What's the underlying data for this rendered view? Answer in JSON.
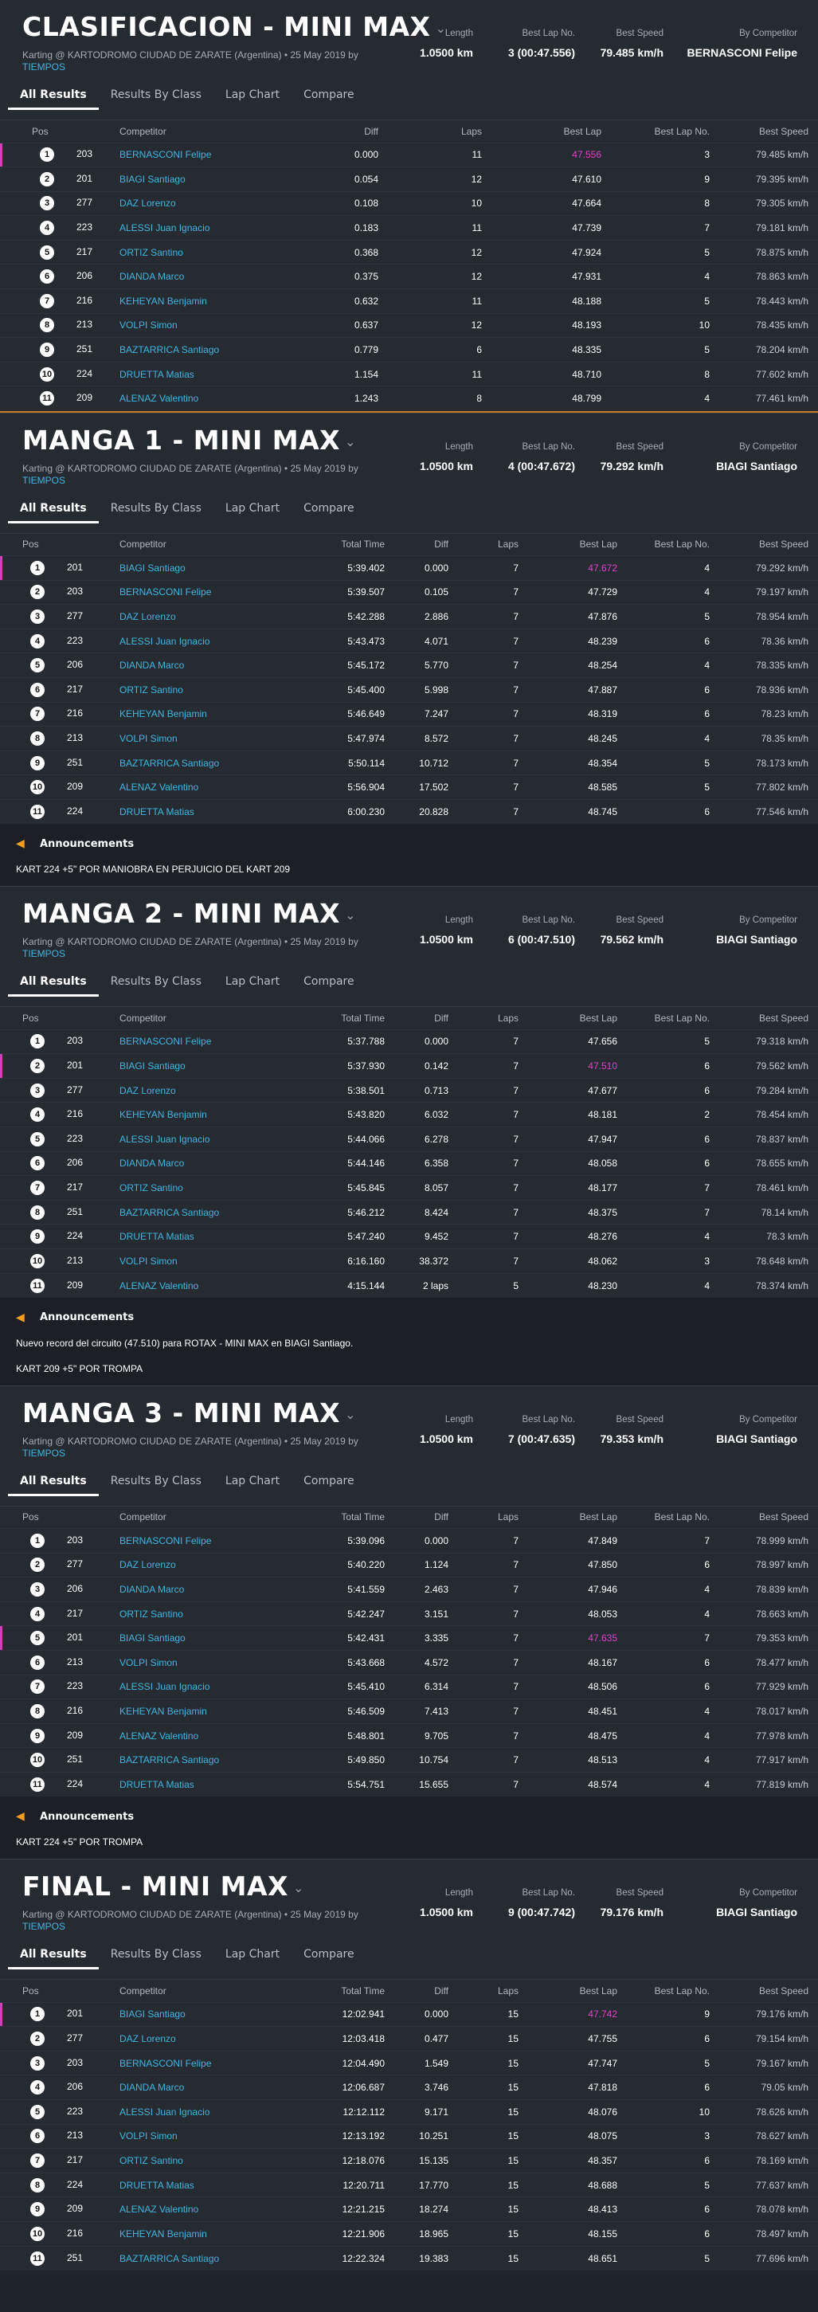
{
  "tabs": [
    "All Results",
    "Results By Class",
    "Lap Chart",
    "Compare"
  ],
  "sections": [
    {
      "title": "CLASIFICACION - MINI MAX",
      "subtitle": "Karting @ KARTODROMO CIUDAD DE ZARATE (Argentina) • 25 May 2019 by",
      "subtitle_link": "TIEMPOS",
      "stats": {
        "length_label": "Length",
        "length": "1.0500 km",
        "bestlap_label": "Best Lap No.",
        "bestlap": "3 (00:47.556)",
        "speed_label": "Best Speed",
        "speed": "79.485 km/h",
        "comp_label": "By Competitor",
        "comp": "BERNASCONI Felipe"
      },
      "columns": [
        "Pos",
        "Competitor",
        "Diff",
        "Laps",
        "Best Lap",
        "Best Lap No.",
        "Best Speed"
      ],
      "rows": [
        {
          "pos": "1",
          "kart": "203",
          "name": "BERNASCONI Felipe",
          "diff": "0.000",
          "laps": "11",
          "best": "47.556",
          "blno": "3",
          "speed": "79.485 km/h",
          "hl": true
        },
        {
          "pos": "2",
          "kart": "201",
          "name": "BIAGI Santiago",
          "diff": "0.054",
          "laps": "12",
          "best": "47.610",
          "blno": "9",
          "speed": "79.395 km/h"
        },
        {
          "pos": "3",
          "kart": "277",
          "name": "DAZ Lorenzo",
          "diff": "0.108",
          "laps": "10",
          "best": "47.664",
          "blno": "8",
          "speed": "79.305 km/h"
        },
        {
          "pos": "4",
          "kart": "223",
          "name": "ALESSI Juan Ignacio",
          "diff": "0.183",
          "laps": "11",
          "best": "47.739",
          "blno": "7",
          "speed": "79.181 km/h"
        },
        {
          "pos": "5",
          "kart": "217",
          "name": "ORTIZ Santino",
          "diff": "0.368",
          "laps": "12",
          "best": "47.924",
          "blno": "5",
          "speed": "78.875 km/h"
        },
        {
          "pos": "6",
          "kart": "206",
          "name": "DIANDA Marco",
          "diff": "0.375",
          "laps": "12",
          "best": "47.931",
          "blno": "4",
          "speed": "78.863 km/h"
        },
        {
          "pos": "7",
          "kart": "216",
          "name": "KEHEYAN Benjamin",
          "diff": "0.632",
          "laps": "11",
          "best": "48.188",
          "blno": "5",
          "speed": "78.443 km/h"
        },
        {
          "pos": "8",
          "kart": "213",
          "name": "VOLPI Simon",
          "diff": "0.637",
          "laps": "12",
          "best": "48.193",
          "blno": "10",
          "speed": "78.435 km/h"
        },
        {
          "pos": "9",
          "kart": "251",
          "name": "BAZTARRICA Santiago",
          "diff": "0.779",
          "laps": "6",
          "best": "48.335",
          "blno": "5",
          "speed": "78.204 km/h"
        },
        {
          "pos": "10",
          "kart": "224",
          "name": "DRUETTA Matias",
          "diff": "1.154",
          "laps": "11",
          "best": "48.710",
          "blno": "8",
          "speed": "77.602 km/h"
        },
        {
          "pos": "11",
          "kart": "209",
          "name": "ALENAZ Valentino",
          "diff": "1.243",
          "laps": "8",
          "best": "48.799",
          "blno": "4",
          "speed": "77.461 km/h"
        }
      ]
    },
    {
      "title": "MANGA 1 - MINI MAX",
      "subtitle": "Karting @ KARTODROMO CIUDAD DE ZARATE (Argentina) • 25 May 2019 by",
      "subtitle_link": "TIEMPOS",
      "stats": {
        "length_label": "Length",
        "length": "1.0500 km",
        "bestlap_label": "Best Lap No.",
        "bestlap": "4 (00:47.672)",
        "speed_label": "Best Speed",
        "speed": "79.292 km/h",
        "comp_label": "By Competitor",
        "comp": "BIAGI Santiago"
      },
      "columns": [
        "Pos",
        "Competitor",
        "Total Time",
        "Diff",
        "Laps",
        "Best Lap",
        "Best Lap No.",
        "Best Speed"
      ],
      "rows": [
        {
          "pos": "1",
          "kart": "201",
          "name": "BIAGI Santiago",
          "total": "5:39.402",
          "diff": "0.000",
          "laps": "7",
          "best": "47.672",
          "blno": "4",
          "speed": "79.292 km/h",
          "hl": true
        },
        {
          "pos": "2",
          "kart": "203",
          "name": "BERNASCONI Felipe",
          "total": "5:39.507",
          "diff": "0.105",
          "laps": "7",
          "best": "47.729",
          "blno": "4",
          "speed": "79.197 km/h"
        },
        {
          "pos": "3",
          "kart": "277",
          "name": "DAZ Lorenzo",
          "total": "5:42.288",
          "diff": "2.886",
          "laps": "7",
          "best": "47.876",
          "blno": "5",
          "speed": "78.954 km/h"
        },
        {
          "pos": "4",
          "kart": "223",
          "name": "ALESSI Juan Ignacio",
          "total": "5:43.473",
          "diff": "4.071",
          "laps": "7",
          "best": "48.239",
          "blno": "6",
          "speed": "78.36 km/h"
        },
        {
          "pos": "5",
          "kart": "206",
          "name": "DIANDA Marco",
          "total": "5:45.172",
          "diff": "5.770",
          "laps": "7",
          "best": "48.254",
          "blno": "4",
          "speed": "78.335 km/h"
        },
        {
          "pos": "6",
          "kart": "217",
          "name": "ORTIZ Santino",
          "total": "5:45.400",
          "diff": "5.998",
          "laps": "7",
          "best": "47.887",
          "blno": "6",
          "speed": "78.936 km/h"
        },
        {
          "pos": "7",
          "kart": "216",
          "name": "KEHEYAN Benjamin",
          "total": "5:46.649",
          "diff": "7.247",
          "laps": "7",
          "best": "48.319",
          "blno": "6",
          "speed": "78.23 km/h"
        },
        {
          "pos": "8",
          "kart": "213",
          "name": "VOLPI Simon",
          "total": "5:47.974",
          "diff": "8.572",
          "laps": "7",
          "best": "48.245",
          "blno": "4",
          "speed": "78.35 km/h"
        },
        {
          "pos": "9",
          "kart": "251",
          "name": "BAZTARRICA Santiago",
          "total": "5:50.114",
          "diff": "10.712",
          "laps": "7",
          "best": "48.354",
          "blno": "5",
          "speed": "78.173 km/h"
        },
        {
          "pos": "10",
          "kart": "209",
          "name": "ALENAZ Valentino",
          "total": "5:56.904",
          "diff": "17.502",
          "laps": "7",
          "best": "48.585",
          "blno": "5",
          "speed": "77.802 km/h"
        },
        {
          "pos": "11",
          "kart": "224",
          "name": "DRUETTA Matias",
          "total": "6:00.230",
          "diff": "20.828",
          "laps": "7",
          "best": "48.745",
          "blno": "6",
          "speed": "77.546 km/h"
        }
      ],
      "announcements_title": "Announcements",
      "announcements": [
        "KART 224 +5\" POR MANIOBRA EN PERJUICIO DEL KART 209"
      ]
    },
    {
      "title": "MANGA 2 - MINI MAX",
      "subtitle": "Karting @ KARTODROMO CIUDAD DE ZARATE (Argentina) • 25 May 2019 by",
      "subtitle_link": "TIEMPOS",
      "stats": {
        "length_label": "Length",
        "length": "1.0500 km",
        "bestlap_label": "Best Lap No.",
        "bestlap": "6 (00:47.510)",
        "speed_label": "Best Speed",
        "speed": "79.562 km/h",
        "comp_label": "By Competitor",
        "comp": "BIAGI Santiago"
      },
      "columns": [
        "Pos",
        "Competitor",
        "Total Time",
        "Diff",
        "Laps",
        "Best Lap",
        "Best Lap No.",
        "Best Speed"
      ],
      "rows": [
        {
          "pos": "1",
          "kart": "203",
          "name": "BERNASCONI Felipe",
          "total": "5:37.788",
          "diff": "0.000",
          "laps": "7",
          "best": "47.656",
          "blno": "5",
          "speed": "79.318 km/h"
        },
        {
          "pos": "2",
          "kart": "201",
          "name": "BIAGI Santiago",
          "total": "5:37.930",
          "diff": "0.142",
          "laps": "7",
          "best": "47.510",
          "blno": "6",
          "speed": "79.562 km/h",
          "hl": true
        },
        {
          "pos": "3",
          "kart": "277",
          "name": "DAZ Lorenzo",
          "total": "5:38.501",
          "diff": "0.713",
          "laps": "7",
          "best": "47.677",
          "blno": "6",
          "speed": "79.284 km/h"
        },
        {
          "pos": "4",
          "kart": "216",
          "name": "KEHEYAN Benjamin",
          "total": "5:43.820",
          "diff": "6.032",
          "laps": "7",
          "best": "48.181",
          "blno": "2",
          "speed": "78.454 km/h"
        },
        {
          "pos": "5",
          "kart": "223",
          "name": "ALESSI Juan Ignacio",
          "total": "5:44.066",
          "diff": "6.278",
          "laps": "7",
          "best": "47.947",
          "blno": "6",
          "speed": "78.837 km/h"
        },
        {
          "pos": "6",
          "kart": "206",
          "name": "DIANDA Marco",
          "total": "5:44.146",
          "diff": "6.358",
          "laps": "7",
          "best": "48.058",
          "blno": "6",
          "speed": "78.655 km/h"
        },
        {
          "pos": "7",
          "kart": "217",
          "name": "ORTIZ Santino",
          "total": "5:45.845",
          "diff": "8.057",
          "laps": "7",
          "best": "48.177",
          "blno": "7",
          "speed": "78.461 km/h"
        },
        {
          "pos": "8",
          "kart": "251",
          "name": "BAZTARRICA Santiago",
          "total": "5:46.212",
          "diff": "8.424",
          "laps": "7",
          "best": "48.375",
          "blno": "7",
          "speed": "78.14 km/h"
        },
        {
          "pos": "9",
          "kart": "224",
          "name": "DRUETTA Matias",
          "total": "5:47.240",
          "diff": "9.452",
          "laps": "7",
          "best": "48.276",
          "blno": "4",
          "speed": "78.3 km/h"
        },
        {
          "pos": "10",
          "kart": "213",
          "name": "VOLPI Simon",
          "total": "6:16.160",
          "diff": "38.372",
          "laps": "7",
          "best": "48.062",
          "blno": "3",
          "speed": "78.648 km/h"
        },
        {
          "pos": "11",
          "kart": "209",
          "name": "ALENAZ Valentino",
          "total": "4:15.144",
          "diff": "2 laps",
          "laps": "5",
          "best": "48.230",
          "blno": "4",
          "speed": "78.374 km/h"
        }
      ],
      "announcements_title": "Announcements",
      "announcements": [
        "Nuevo record del circuito (47.510) para ROTAX - MINI MAX en BIAGI Santiago.",
        "KART 209 +5\" POR TROMPA"
      ]
    },
    {
      "title": "MANGA 3 - MINI MAX",
      "subtitle": "Karting @ KARTODROMO CIUDAD DE ZARATE (Argentina) • 25 May 2019 by",
      "subtitle_link": "TIEMPOS",
      "stats": {
        "length_label": "Length",
        "length": "1.0500 km",
        "bestlap_label": "Best Lap No.",
        "bestlap": "7 (00:47.635)",
        "speed_label": "Best Speed",
        "speed": "79.353 km/h",
        "comp_label": "By Competitor",
        "comp": "BIAGI Santiago"
      },
      "columns": [
        "Pos",
        "Competitor",
        "Total Time",
        "Diff",
        "Laps",
        "Best Lap",
        "Best Lap No.",
        "Best Speed"
      ],
      "rows": [
        {
          "pos": "1",
          "kart": "203",
          "name": "BERNASCONI Felipe",
          "total": "5:39.096",
          "diff": "0.000",
          "laps": "7",
          "best": "47.849",
          "blno": "7",
          "speed": "78.999 km/h"
        },
        {
          "pos": "2",
          "kart": "277",
          "name": "DAZ Lorenzo",
          "total": "5:40.220",
          "diff": "1.124",
          "laps": "7",
          "best": "47.850",
          "blno": "6",
          "speed": "78.997 km/h"
        },
        {
          "pos": "3",
          "kart": "206",
          "name": "DIANDA Marco",
          "total": "5:41.559",
          "diff": "2.463",
          "laps": "7",
          "best": "47.946",
          "blno": "4",
          "speed": "78.839 km/h"
        },
        {
          "pos": "4",
          "kart": "217",
          "name": "ORTIZ Santino",
          "total": "5:42.247",
          "diff": "3.151",
          "laps": "7",
          "best": "48.053",
          "blno": "4",
          "speed": "78.663 km/h"
        },
        {
          "pos": "5",
          "kart": "201",
          "name": "BIAGI Santiago",
          "total": "5:42.431",
          "diff": "3.335",
          "laps": "7",
          "best": "47.635",
          "blno": "7",
          "speed": "79.353 km/h",
          "hl": true
        },
        {
          "pos": "6",
          "kart": "213",
          "name": "VOLPI Simon",
          "total": "5:43.668",
          "diff": "4.572",
          "laps": "7",
          "best": "48.167",
          "blno": "6",
          "speed": "78.477 km/h"
        },
        {
          "pos": "7",
          "kart": "223",
          "name": "ALESSI Juan Ignacio",
          "total": "5:45.410",
          "diff": "6.314",
          "laps": "7",
          "best": "48.506",
          "blno": "6",
          "speed": "77.929 km/h"
        },
        {
          "pos": "8",
          "kart": "216",
          "name": "KEHEYAN Benjamin",
          "total": "5:46.509",
          "diff": "7.413",
          "laps": "7",
          "best": "48.451",
          "blno": "4",
          "speed": "78.017 km/h"
        },
        {
          "pos": "9",
          "kart": "209",
          "name": "ALENAZ Valentino",
          "total": "5:48.801",
          "diff": "9.705",
          "laps": "7",
          "best": "48.475",
          "blno": "4",
          "speed": "77.978 km/h"
        },
        {
          "pos": "10",
          "kart": "251",
          "name": "BAZTARRICA Santiago",
          "total": "5:49.850",
          "diff": "10.754",
          "laps": "7",
          "best": "48.513",
          "blno": "4",
          "speed": "77.917 km/h"
        },
        {
          "pos": "11",
          "kart": "224",
          "name": "DRUETTA Matias",
          "total": "5:54.751",
          "diff": "15.655",
          "laps": "7",
          "best": "48.574",
          "blno": "4",
          "speed": "77.819 km/h"
        }
      ],
      "announcements_title": "Announcements",
      "announcements": [
        "KART 224 +5\" POR TROMPA"
      ]
    },
    {
      "title": "FINAL - MINI MAX",
      "subtitle": "Karting @ KARTODROMO CIUDAD DE ZARATE (Argentina) • 25 May 2019 by",
      "subtitle_link": "TIEMPOS",
      "stats": {
        "length_label": "Length",
        "length": "1.0500 km",
        "bestlap_label": "Best Lap No.",
        "bestlap": "9 (00:47.742)",
        "speed_label": "Best Speed",
        "speed": "79.176 km/h",
        "comp_label": "By Competitor",
        "comp": "BIAGI Santiago"
      },
      "columns": [
        "Pos",
        "Competitor",
        "Total Time",
        "Diff",
        "Laps",
        "Best Lap",
        "Best Lap No.",
        "Best Speed"
      ],
      "rows": [
        {
          "pos": "1",
          "kart": "201",
          "name": "BIAGI Santiago",
          "total": "12:02.941",
          "diff": "0.000",
          "laps": "15",
          "best": "47.742",
          "blno": "9",
          "speed": "79.176 km/h",
          "hl": true
        },
        {
          "pos": "2",
          "kart": "277",
          "name": "DAZ Lorenzo",
          "total": "12:03.418",
          "diff": "0.477",
          "laps": "15",
          "best": "47.755",
          "blno": "6",
          "speed": "79.154 km/h"
        },
        {
          "pos": "3",
          "kart": "203",
          "name": "BERNASCONI Felipe",
          "total": "12:04.490",
          "diff": "1.549",
          "laps": "15",
          "best": "47.747",
          "blno": "5",
          "speed": "79.167 km/h"
        },
        {
          "pos": "4",
          "kart": "206",
          "name": "DIANDA Marco",
          "total": "12:06.687",
          "diff": "3.746",
          "laps": "15",
          "best": "47.818",
          "blno": "6",
          "speed": "79.05 km/h"
        },
        {
          "pos": "5",
          "kart": "223",
          "name": "ALESSI Juan Ignacio",
          "total": "12:12.112",
          "diff": "9.171",
          "laps": "15",
          "best": "48.076",
          "blno": "10",
          "speed": "78.626 km/h"
        },
        {
          "pos": "6",
          "kart": "213",
          "name": "VOLPI Simon",
          "total": "12:13.192",
          "diff": "10.251",
          "laps": "15",
          "best": "48.075",
          "blno": "3",
          "speed": "78.627 km/h"
        },
        {
          "pos": "7",
          "kart": "217",
          "name": "ORTIZ Santino",
          "total": "12:18.076",
          "diff": "15.135",
          "laps": "15",
          "best": "48.357",
          "blno": "6",
          "speed": "78.169 km/h"
        },
        {
          "pos": "8",
          "kart": "224",
          "name": "DRUETTA Matias",
          "total": "12:20.711",
          "diff": "17.770",
          "laps": "15",
          "best": "48.688",
          "blno": "5",
          "speed": "77.637 km/h"
        },
        {
          "pos": "9",
          "kart": "209",
          "name": "ALENAZ Valentino",
          "total": "12:21.215",
          "diff": "18.274",
          "laps": "15",
          "best": "48.413",
          "blno": "6",
          "speed": "78.078 km/h"
        },
        {
          "pos": "10",
          "kart": "216",
          "name": "KEHEYAN Benjamin",
          "total": "12:21.906",
          "diff": "18.965",
          "laps": "15",
          "best": "48.155",
          "blno": "6",
          "speed": "78.497 km/h"
        },
        {
          "pos": "11",
          "kart": "251",
          "name": "BAZTARRICA Santiago",
          "total": "12:22.324",
          "diff": "19.383",
          "laps": "15",
          "best": "48.651",
          "blno": "5",
          "speed": "77.696 km/h"
        }
      ]
    }
  ]
}
